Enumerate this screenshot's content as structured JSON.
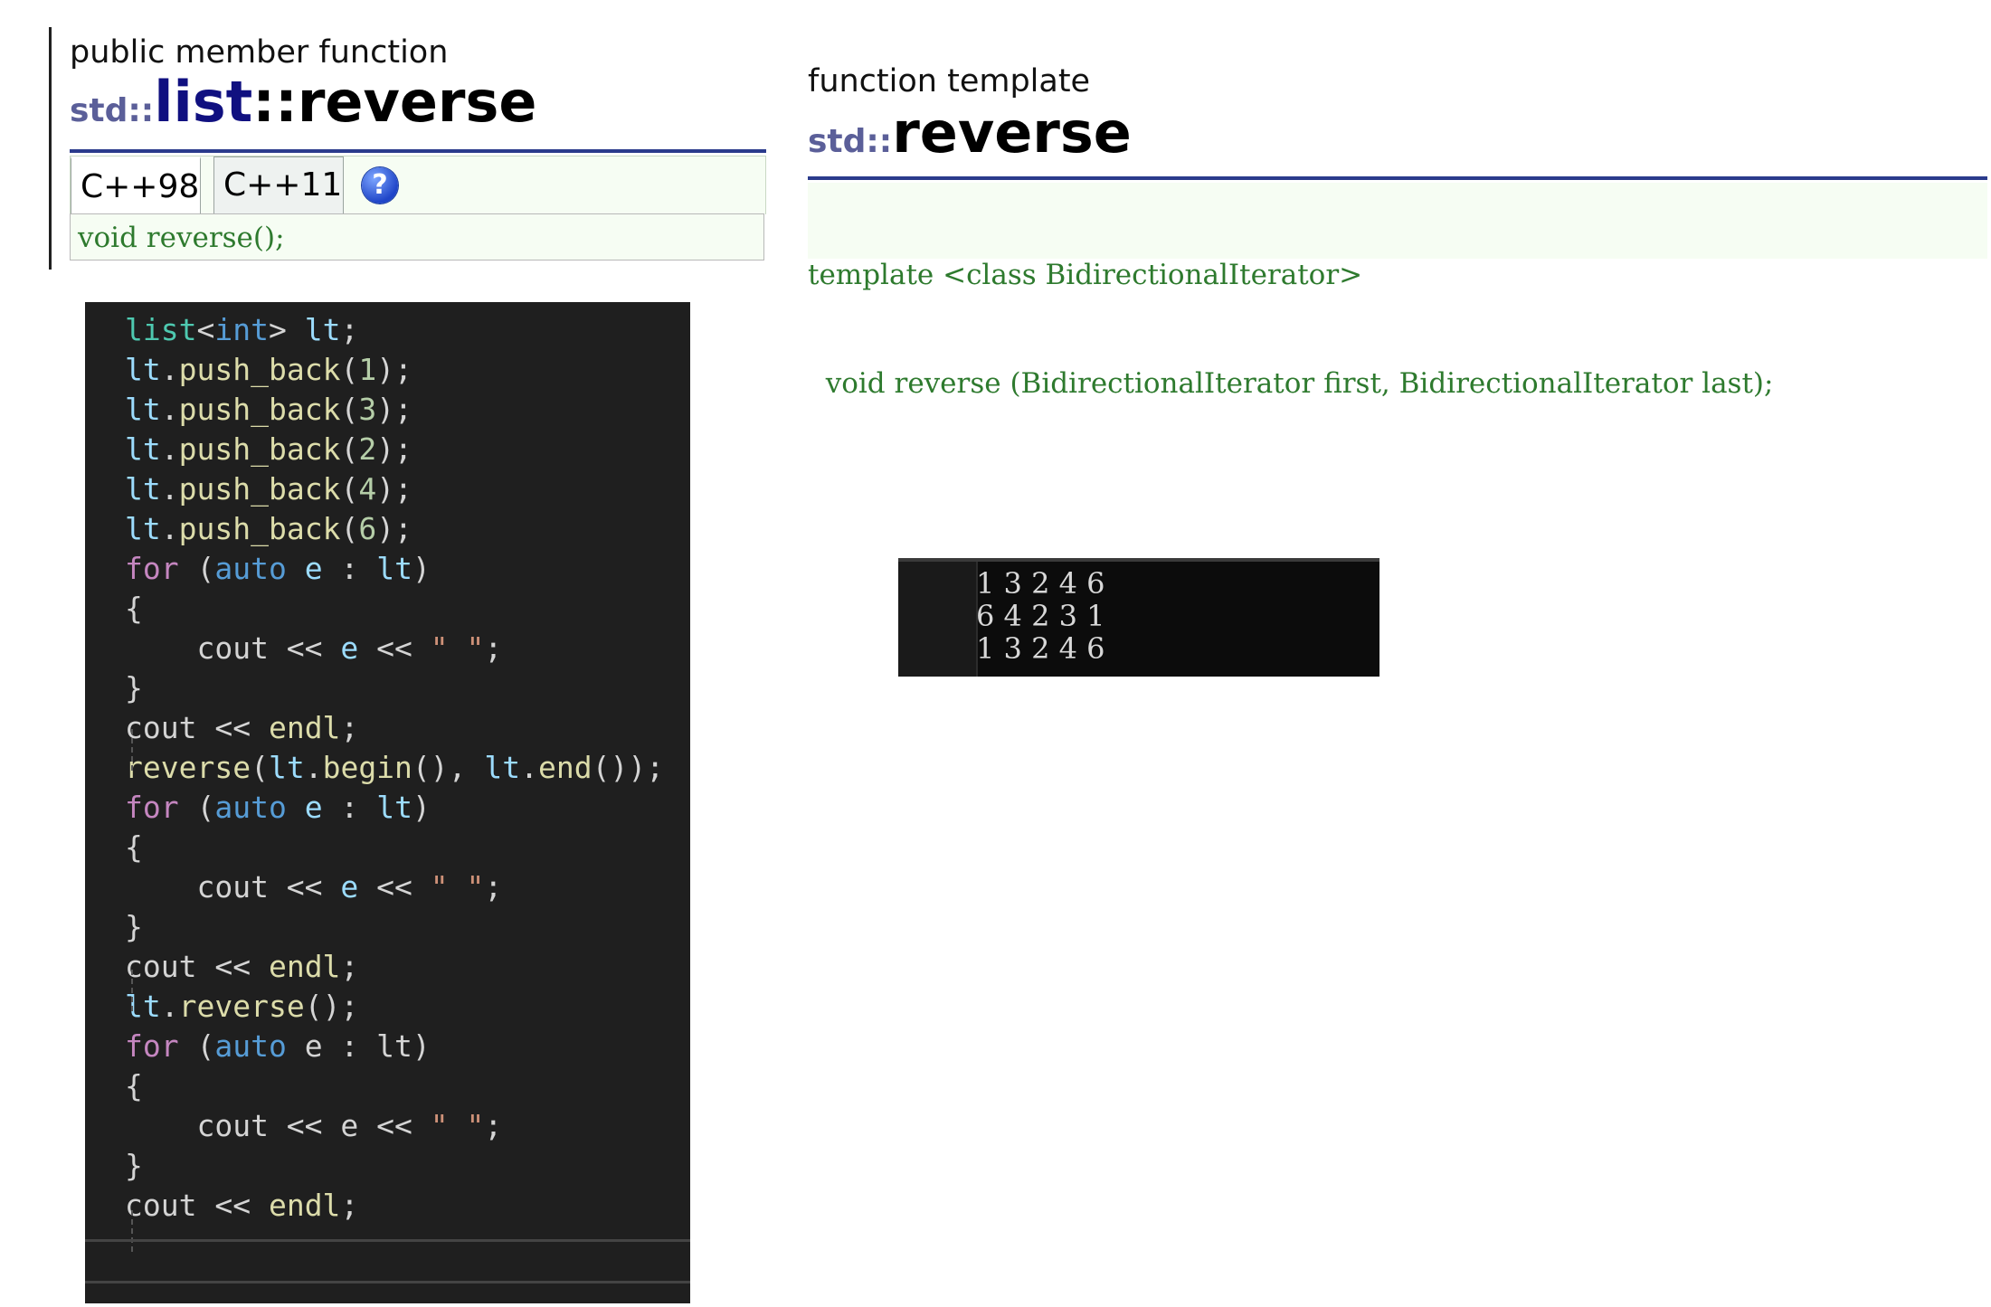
{
  "left_reference": {
    "kind": "public member function",
    "namespace": "std::",
    "class_name": "list",
    "separator": "::",
    "function_name": "reverse",
    "tabs": [
      {
        "label": "C++98"
      },
      {
        "label": "C++11"
      }
    ],
    "help_icon": "?",
    "declaration": "void reverse();"
  },
  "right_reference": {
    "kind": "function template",
    "namespace": "std::",
    "function_name": "reverse",
    "declaration_lines": [
      "template <class BidirectionalIterator>",
      "  void reverse (BidirectionalIterator first, BidirectionalIterator last);"
    ]
  },
  "code": {
    "lines": [
      [
        {
          "t": "list",
          "c": "t-type"
        },
        {
          "t": "<",
          "c": "t-op"
        },
        {
          "t": "int",
          "c": "t-kw2"
        },
        {
          "t": ">",
          "c": "t-op"
        },
        {
          "t": " lt",
          "c": "t-var"
        },
        {
          "t": ";",
          "c": "t-op"
        }
      ],
      [
        {
          "t": "lt",
          "c": "t-var"
        },
        {
          "t": ".",
          "c": "t-op"
        },
        {
          "t": "push_back",
          "c": "t-fn"
        },
        {
          "t": "(",
          "c": "t-op"
        },
        {
          "t": "1",
          "c": "t-num"
        },
        {
          "t": ");",
          "c": "t-op"
        }
      ],
      [
        {
          "t": "lt",
          "c": "t-var"
        },
        {
          "t": ".",
          "c": "t-op"
        },
        {
          "t": "push_back",
          "c": "t-fn"
        },
        {
          "t": "(",
          "c": "t-op"
        },
        {
          "t": "3",
          "c": "t-num"
        },
        {
          "t": ");",
          "c": "t-op"
        }
      ],
      [
        {
          "t": "lt",
          "c": "t-var"
        },
        {
          "t": ".",
          "c": "t-op"
        },
        {
          "t": "push_back",
          "c": "t-fn"
        },
        {
          "t": "(",
          "c": "t-op"
        },
        {
          "t": "2",
          "c": "t-num"
        },
        {
          "t": ");",
          "c": "t-op"
        }
      ],
      [
        {
          "t": "lt",
          "c": "t-var"
        },
        {
          "t": ".",
          "c": "t-op"
        },
        {
          "t": "push_back",
          "c": "t-fn"
        },
        {
          "t": "(",
          "c": "t-op"
        },
        {
          "t": "4",
          "c": "t-num"
        },
        {
          "t": ");",
          "c": "t-op"
        }
      ],
      [
        {
          "t": "lt",
          "c": "t-var"
        },
        {
          "t": ".",
          "c": "t-op"
        },
        {
          "t": "push_back",
          "c": "t-fn"
        },
        {
          "t": "(",
          "c": "t-op"
        },
        {
          "t": "6",
          "c": "t-num"
        },
        {
          "t": ");",
          "c": "t-op"
        }
      ],
      [
        {
          "t": "for",
          "c": "t-kw"
        },
        {
          "t": " (",
          "c": "t-op"
        },
        {
          "t": "auto",
          "c": "t-kw2"
        },
        {
          "t": " e",
          "c": "t-var"
        },
        {
          "t": " : ",
          "c": "t-op"
        },
        {
          "t": "lt",
          "c": "t-var"
        },
        {
          "t": ")",
          "c": "t-op"
        }
      ],
      [
        {
          "t": "{",
          "c": "t-op"
        }
      ],
      [
        {
          "t": "    cout << ",
          "c": "t-op"
        },
        {
          "t": "e",
          "c": "t-var"
        },
        {
          "t": " << ",
          "c": "t-op"
        },
        {
          "t": "\" \"",
          "c": "t-str"
        },
        {
          "t": ";",
          "c": "t-op"
        }
      ],
      [
        {
          "t": "}",
          "c": "t-op"
        }
      ],
      [
        {
          "t": "cout << ",
          "c": "t-op"
        },
        {
          "t": "endl",
          "c": "t-fn"
        },
        {
          "t": ";",
          "c": "t-op"
        }
      ],
      [
        {
          "t": "reverse",
          "c": "t-fn"
        },
        {
          "t": "(",
          "c": "t-op"
        },
        {
          "t": "lt",
          "c": "t-var"
        },
        {
          "t": ".",
          "c": "t-op"
        },
        {
          "t": "begin",
          "c": "t-fn"
        },
        {
          "t": "(), ",
          "c": "t-op"
        },
        {
          "t": "lt",
          "c": "t-var"
        },
        {
          "t": ".",
          "c": "t-op"
        },
        {
          "t": "end",
          "c": "t-fn"
        },
        {
          "t": "());",
          "c": "t-op"
        }
      ],
      [
        {
          "t": "for",
          "c": "t-kw"
        },
        {
          "t": " (",
          "c": "t-op"
        },
        {
          "t": "auto",
          "c": "t-kw2"
        },
        {
          "t": " e",
          "c": "t-var"
        },
        {
          "t": " : ",
          "c": "t-op"
        },
        {
          "t": "lt",
          "c": "t-var"
        },
        {
          "t": ")",
          "c": "t-op"
        }
      ],
      [
        {
          "t": "{",
          "c": "t-op"
        }
      ],
      [
        {
          "t": "    cout << ",
          "c": "t-op"
        },
        {
          "t": "e",
          "c": "t-var"
        },
        {
          "t": " << ",
          "c": "t-op"
        },
        {
          "t": "\" \"",
          "c": "t-str"
        },
        {
          "t": ";",
          "c": "t-op"
        }
      ],
      [
        {
          "t": "}",
          "c": "t-op"
        }
      ],
      [
        {
          "t": "cout << ",
          "c": "t-op"
        },
        {
          "t": "endl",
          "c": "t-fn"
        },
        {
          "t": ";",
          "c": "t-op"
        }
      ],
      [
        {
          "t": "lt",
          "c": "t-var"
        },
        {
          "t": ".",
          "c": "t-op"
        },
        {
          "t": "reverse",
          "c": "t-fn"
        },
        {
          "t": "();",
          "c": "t-op"
        }
      ],
      [
        {
          "t": "for",
          "c": "t-kw"
        },
        {
          "t": " (",
          "c": "t-op"
        },
        {
          "t": "auto",
          "c": "t-kw2"
        },
        {
          "t": " e : lt",
          "c": "t-op"
        },
        {
          "t": ")",
          "c": "t-op"
        }
      ],
      [
        {
          "t": "{",
          "c": "t-op"
        }
      ],
      [
        {
          "t": "    cout << e << ",
          "c": "t-op"
        },
        {
          "t": "\" \"",
          "c": "t-str"
        },
        {
          "t": ";",
          "c": "t-op"
        }
      ],
      [
        {
          "t": "}",
          "c": "t-op"
        }
      ],
      [
        {
          "t": "cout << ",
          "c": "t-op"
        },
        {
          "t": "endl",
          "c": "t-fn"
        },
        {
          "t": ";",
          "c": "t-op"
        }
      ]
    ]
  },
  "console": {
    "lines": [
      "1 3 2 4 6",
      "6 4 2 3 1",
      "1 3 2 4 6"
    ]
  }
}
